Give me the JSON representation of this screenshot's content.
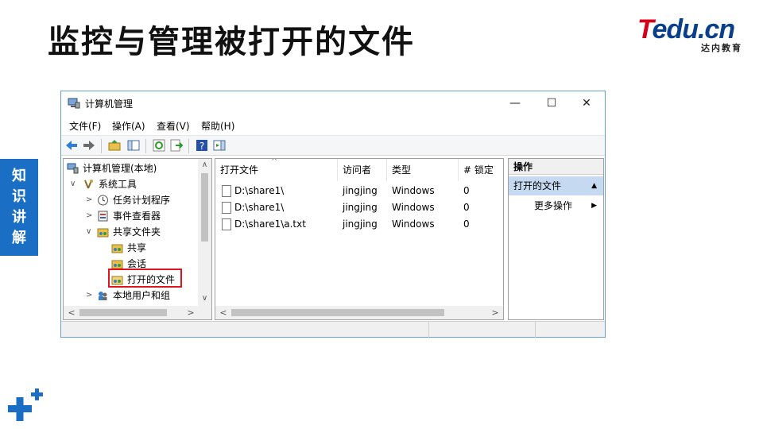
{
  "slide": {
    "title": "监控与管理被打开的文件",
    "side_tab": [
      "知",
      "识",
      "讲",
      "解"
    ]
  },
  "logo": {
    "main_t": "T",
    "main_rest": "edu.cn",
    "sub": "达内教育",
    "colors": {
      "t": "#d6001c",
      "rest": "#0a3f8c"
    }
  },
  "window": {
    "title": "计算机管理",
    "controls": {
      "minimize": "—",
      "maximize": "☐",
      "close": "✕"
    },
    "menu": [
      "文件(F)",
      "操作(A)",
      "查看(V)",
      "帮助(H)"
    ],
    "toolbar_icons": [
      "back-arrow-icon",
      "forward-arrow-icon",
      "folder-up-icon",
      "console-tree-icon",
      "refresh-icon",
      "export-list-icon",
      "help-icon",
      "action-pane-icon"
    ]
  },
  "tree": {
    "items": [
      {
        "label": "计算机管理(本地)",
        "level": 0,
        "expander": "",
        "icon": "computer-management-icon"
      },
      {
        "label": "系统工具",
        "level": 1,
        "expander": "∨",
        "icon": "system-tools-icon"
      },
      {
        "label": "任务计划程序",
        "level": 2,
        "expander": ">",
        "icon": "task-scheduler-icon"
      },
      {
        "label": "事件查看器",
        "level": 2,
        "expander": ">",
        "icon": "event-viewer-icon"
      },
      {
        "label": "共享文件夹",
        "level": 2,
        "expander": "∨",
        "icon": "shared-folders-icon"
      },
      {
        "label": "共享",
        "level": 3,
        "expander": "",
        "icon": "shares-icon"
      },
      {
        "label": "会话",
        "level": 3,
        "expander": "",
        "icon": "sessions-icon"
      },
      {
        "label": "打开的文件",
        "level": 3,
        "expander": "",
        "icon": "open-files-icon",
        "selected": true
      },
      {
        "label": "本地用户和组",
        "level": 2,
        "expander": ">",
        "icon": "local-users-icon"
      }
    ]
  },
  "list": {
    "columns": [
      "打开文件",
      "访问者",
      "类型",
      "# 锁定"
    ],
    "rows": [
      [
        "D:\\share1\\",
        "jingjing",
        "Windows",
        "0"
      ],
      [
        "D:\\share1\\",
        "jingjing",
        "Windows",
        "0"
      ],
      [
        "D:\\share1\\a.txt",
        "jingjing",
        "Windows",
        "0"
      ]
    ]
  },
  "actions": {
    "header": "操作",
    "section": "打开的文件",
    "item": "更多操作"
  },
  "colors": {
    "side_tab": "#1a6fc4",
    "highlight": "#e0141e",
    "action_section": "#c5d9f1"
  }
}
